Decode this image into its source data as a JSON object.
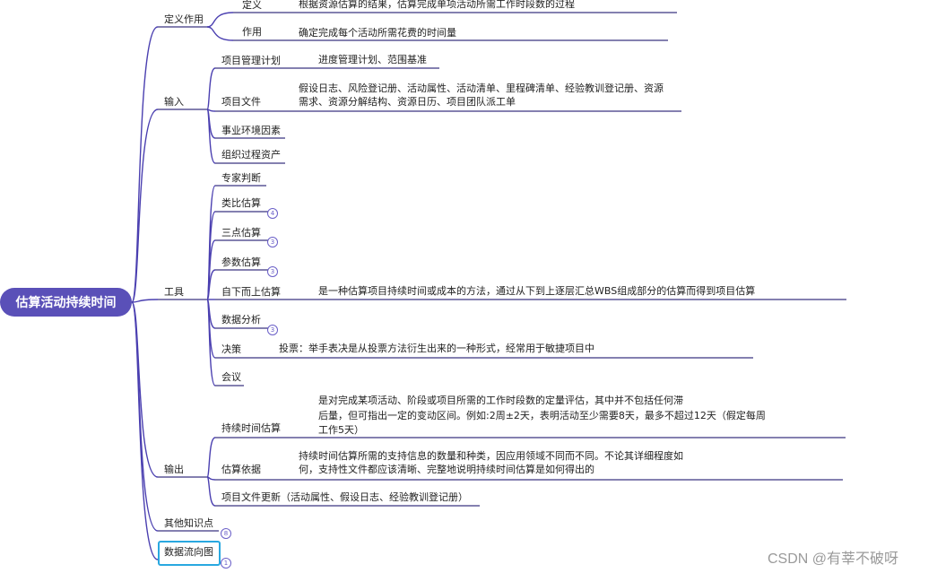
{
  "root": "估算活动持续时间",
  "branches": {
    "define": {
      "label": "定义作用",
      "definition_label": "定义",
      "definition_text": "根据资源估算的结果，估算完成单项活动所需工作时段数的过程",
      "purpose_label": "作用",
      "purpose_text": "确定完成每个活动所需花费的时间量"
    },
    "input": {
      "label": "输入",
      "pm_plan_label": "项目管理计划",
      "pm_plan_text": "进度管理计划、范围基准",
      "project_docs_label": "项目文件",
      "project_docs_text_1": "假设日志、风险登记册、活动属性、活动清单、里程碑清单、经验教训登记册、资源",
      "project_docs_text_2": "需求、资源分解结构、资源日历、项目团队派工单",
      "eef": "事业环境因素",
      "opa": "组织过程资产"
    },
    "tools": {
      "label": "工具",
      "expert": "专家判断",
      "analogous": "类比估算",
      "analogous_badge": "4",
      "three_point": "三点估算",
      "three_point_badge": "3",
      "parametric": "参数估算",
      "parametric_badge": "3",
      "bottom_up": "自下而上估算",
      "bottom_up_text": "是一种估算项目持续时间或成本的方法，通过从下到上逐层汇总WBS组成部分的估算而得到项目估算",
      "data_analysis": "数据分析",
      "data_analysis_badge": "3",
      "decision": "决策",
      "decision_text": "投票：举手表决是从投票方法衍生出来的一种形式，经常用于敏捷项目中",
      "meeting": "会议"
    },
    "output": {
      "label": "输出",
      "duration_estimates": "持续时间估算",
      "duration_estimates_text_1": "是对完成某项活动、阶段或项目所需的工作时段数的定量评估，其中并不包括任何滞",
      "duration_estimates_text_2": "后量，但可指出一定的变动区间。例如:2周±2天，表明活动至少需要8天，最多不超过12天（假定每周",
      "duration_estimates_text_3": "工作5天）",
      "basis": "估算依据",
      "basis_text_1": "持续时间估算所需的支持信息的数量和种类，因应用领域不同而不同。不论其详细程度如",
      "basis_text_2": "何，支持性文件都应该清晰、完整地说明持续时间估算是如何得出的",
      "doc_updates": "项目文件更新（活动属性、假设日志、经验教训登记册）"
    },
    "other": {
      "label": "其他知识点",
      "badge": "8"
    },
    "dfd": {
      "label": "数据流向图",
      "badge": "1"
    }
  },
  "watermark": "CSDN @有莘不破呀",
  "colors": {
    "root_fill": "#5a50b8",
    "edge": "#4a3fb0",
    "underline": "#3b3480",
    "selection": "#29a8e0"
  }
}
